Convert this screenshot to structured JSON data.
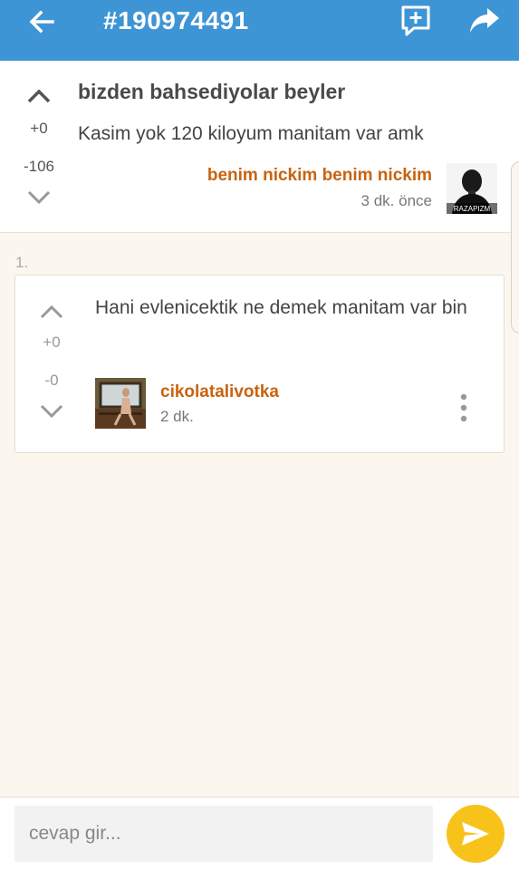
{
  "topbar": {
    "title": "#190974491",
    "back_icon": "arrow-left-icon",
    "add_comment_icon": "comment-add-icon",
    "share_icon": "share-icon",
    "color": "#3e95d6"
  },
  "entry": {
    "heading": "bizden bahsediyolar beyler",
    "body": "Kasim yok 120 kiloyum manitam var amk",
    "upvotes": "+0",
    "downvotes": "-106",
    "author": "benim nickim benim nickim",
    "time": "3 dk. önce",
    "avatar_text": "RAZAPIZM"
  },
  "replies": [
    {
      "index": "1.",
      "body": "Hani evlenicektik ne demek manitam var bin",
      "upvotes": "+0",
      "downvotes": "-0",
      "author": "cikolatalivotka",
      "time": "2 dk."
    }
  ],
  "composer": {
    "placeholder": "cevap gir...",
    "send_icon": "send-icon",
    "send_color": "#f7c21a"
  },
  "colors": {
    "author": "#c8630f",
    "background": "#fbf7ee"
  }
}
